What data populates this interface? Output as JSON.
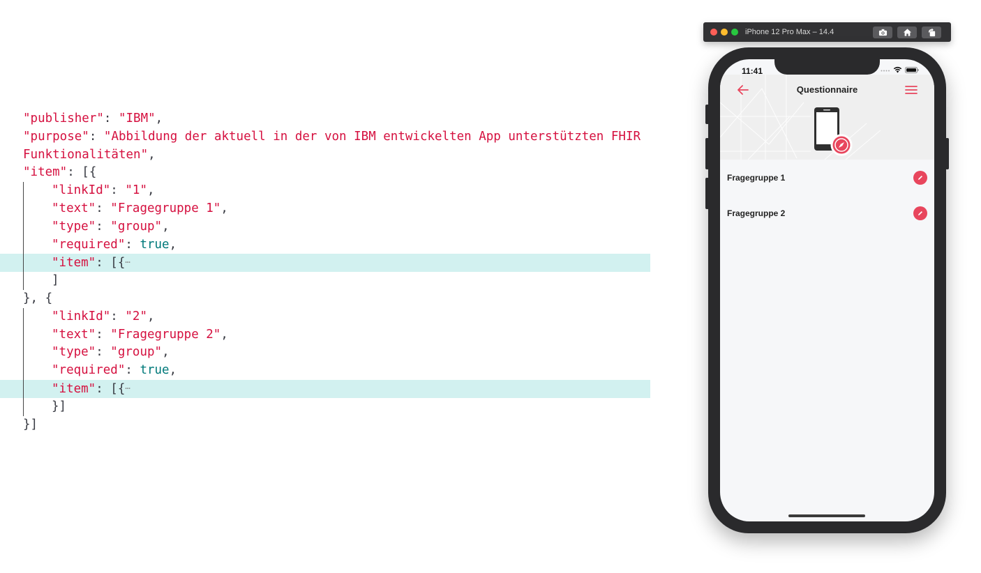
{
  "code": {
    "lines": [
      [
        {
          "t": "\"publisher\"",
          "c": "k"
        },
        {
          "t": ": ",
          "c": "p"
        },
        {
          "t": "\"IBM\"",
          "c": "s"
        },
        {
          "t": ",",
          "c": "p"
        }
      ],
      [
        {
          "t": "\"purpose\"",
          "c": "k"
        },
        {
          "t": ": ",
          "c": "p"
        },
        {
          "t": "\"Abbildung der aktuell in der von IBM entwickelten App unterstützten FHIR",
          "c": "s"
        }
      ],
      [
        {
          "t": "Funktionalitäten\"",
          "c": "s"
        },
        {
          "t": ",",
          "c": "p"
        }
      ],
      [
        {
          "t": "\"item\"",
          "c": "k"
        },
        {
          "t": ": [{",
          "c": "p"
        }
      ],
      [
        {
          "t": "\"linkId\"",
          "c": "k"
        },
        {
          "t": ": ",
          "c": "p"
        },
        {
          "t": "\"1\"",
          "c": "s"
        },
        {
          "t": ",",
          "c": "p"
        }
      ],
      [
        {
          "t": "\"text\"",
          "c": "k"
        },
        {
          "t": ": ",
          "c": "p"
        },
        {
          "t": "\"Fragegruppe 1\"",
          "c": "s"
        },
        {
          "t": ",",
          "c": "p"
        }
      ],
      [
        {
          "t": "\"type\"",
          "c": "k"
        },
        {
          "t": ": ",
          "c": "p"
        },
        {
          "t": "\"group\"",
          "c": "s"
        },
        {
          "t": ",",
          "c": "p"
        }
      ],
      [
        {
          "t": "\"required\"",
          "c": "k"
        },
        {
          "t": ": ",
          "c": "p"
        },
        {
          "t": "true",
          "c": "b"
        },
        {
          "t": ",",
          "c": "p"
        }
      ],
      [
        {
          "t": "\"item\"",
          "c": "k"
        },
        {
          "t": ": [{",
          "c": "p"
        },
        {
          "t": "⋯",
          "c": "fold"
        }
      ],
      [
        {
          "t": "]",
          "c": "p"
        }
      ],
      [
        {
          "t": "}, {",
          "c": "p"
        }
      ],
      [
        {
          "t": "\"linkId\"",
          "c": "k"
        },
        {
          "t": ": ",
          "c": "p"
        },
        {
          "t": "\"2\"",
          "c": "s"
        },
        {
          "t": ",",
          "c": "p"
        }
      ],
      [
        {
          "t": "\"text\"",
          "c": "k"
        },
        {
          "t": ": ",
          "c": "p"
        },
        {
          "t": "\"Fragegruppe 2\"",
          "c": "s"
        },
        {
          "t": ",",
          "c": "p"
        }
      ],
      [
        {
          "t": "\"type\"",
          "c": "k"
        },
        {
          "t": ": ",
          "c": "p"
        },
        {
          "t": "\"group\"",
          "c": "s"
        },
        {
          "t": ",",
          "c": "p"
        }
      ],
      [
        {
          "t": "\"required\"",
          "c": "k"
        },
        {
          "t": ": ",
          "c": "p"
        },
        {
          "t": "true",
          "c": "b"
        },
        {
          "t": ",",
          "c": "p"
        }
      ],
      [
        {
          "t": "\"item\"",
          "c": "k"
        },
        {
          "t": ": [{",
          "c": "p"
        },
        {
          "t": "⋯",
          "c": "fold"
        }
      ],
      [
        {
          "t": "}]",
          "c": "p"
        }
      ],
      [
        {
          "t": "}]",
          "c": "p"
        }
      ]
    ],
    "indented": [
      4,
      5,
      6,
      7,
      8,
      9,
      11,
      12,
      13,
      14,
      15,
      16
    ],
    "highlighted": [
      8,
      15
    ]
  },
  "simulator": {
    "title": "iPhone 12 Pro Max – 14.4",
    "buttons": [
      "screenshot-icon",
      "home-icon",
      "rotate-icon"
    ]
  },
  "app": {
    "status_time": "11:41",
    "title": "Questionnaire",
    "items": [
      {
        "label": "Fragegruppe 1"
      },
      {
        "label": "Fragegruppe 2"
      }
    ]
  },
  "colors": {
    "accent": "#e8465d",
    "code_key": "#d5103f",
    "code_bool": "#00797a",
    "highlight": "#d2f1f0"
  }
}
